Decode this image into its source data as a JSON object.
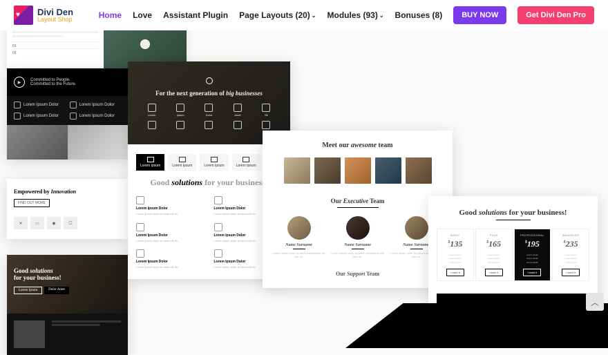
{
  "header": {
    "logo_title": "Divi Den",
    "logo_sub": "Layout Shop",
    "nav": {
      "home": "Home",
      "love": "Love",
      "assistant": "Assistant Plugin",
      "layouts": "Page Layouts (20)",
      "modules": "Modules (93)",
      "bonuses": "Bonuses (8)"
    },
    "buy": "BUY NOW",
    "pro": "Get Divi Den Pro"
  },
  "strip": {
    "tab1": "01",
    "tab2": "02"
  },
  "c1": {
    "tag1": "Committed to People.",
    "tag2": "Committed to the Future.",
    "feat": "Lorem Ipsum Dolor",
    "empowered_pre": "Empowered by ",
    "empowered_em": "Innovation",
    "findout": "FIND OUT MORE",
    "solutions_pre": "Good ",
    "solutions_em": "solutions",
    "solutions_post": " for your business!",
    "b1": "Lorem Ipsum",
    "b2": "Dolor Amet"
  },
  "c2": {
    "hero_pre": "For the next generation of ",
    "hero_em": "big businesses",
    "icons": [
      "Lorem",
      "Ipsum",
      "Dolor",
      "Amet",
      "Sit"
    ],
    "tabs": [
      "Lorem Ipsum",
      "Lorem Ipsum",
      "Lorem Ipsum",
      "Lorem Ipsum"
    ],
    "h_pre": "Good ",
    "h_b": "solutions",
    "h_post": " for your business!",
    "cell_h": "Lorem Ipsum Dolor",
    "cell_p": "Lorem ipsum dolor sit amet elit do."
  },
  "c3": {
    "h1_pre": "Meet our ",
    "h1_em": "awesome",
    "h1_post": " team",
    "h2_pre": "Our ",
    "h2_em": "Executive",
    "h2_post": " Team",
    "name": "Name Surname",
    "bio": "Lorem ipsum dolor sit amet consectetur elit sed do.",
    "h3_pre": "Our ",
    "h3_em": "Support",
    "h3_post": " Team"
  },
  "c4": {
    "h_pre": "Good ",
    "h_b": "solutions",
    "h_post": " for your business!",
    "cols": [
      {
        "label": "BASIC",
        "price": "135"
      },
      {
        "label": "PLUS",
        "price": "165"
      },
      {
        "label": "PROFESSIONAL",
        "price": "195"
      },
      {
        "label": "ADVANCED",
        "price": "235"
      }
    ],
    "li": "Lorem ipsum",
    "btn": "I want it"
  },
  "scrolltop": "︿"
}
